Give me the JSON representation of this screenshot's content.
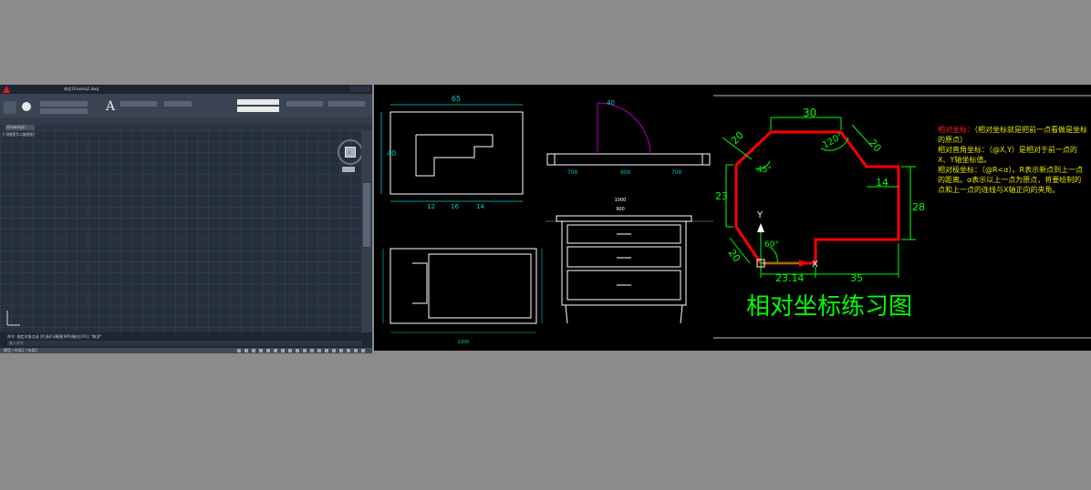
{
  "autocad": {
    "window_title": "欢迎 Drawing1.dwg",
    "file_tab": "Drawing1",
    "viewport_label": "[-][俯视][二维线框]",
    "viewcube_label": "上",
    "command_line": "命令: 指定对角点或 [栏选(F)/圈围(WP)/圈交(CP)]: *取消*",
    "command_prompt": "键入命令",
    "layout_tabs": "模型 / 布局1 / 布局2"
  },
  "furniture_drawings": {
    "top_left": {
      "width": "65",
      "height": "40",
      "dims": [
        "12",
        "16",
        "14"
      ]
    },
    "door": {
      "radius": "40",
      "dims": [
        "700",
        "900",
        "700"
      ]
    },
    "dresser": {
      "overall": "1000",
      "inner": "900"
    },
    "side_view": {
      "total": "2200"
    }
  },
  "coordinate_exercise": {
    "title": "相对坐标练习图",
    "colors": {
      "outline": "#ff0000",
      "dimension": "#00ff00",
      "text_yellow": "#e6e600",
      "text_red": "#ff2020"
    },
    "dims": {
      "top": "30",
      "upper_left_diag": "20",
      "upper_right_diag": "20",
      "left": "23",
      "right": "28",
      "step": "14",
      "lower_left_diag": "20",
      "bottom_left": "23.14",
      "bottom_right": "35",
      "angle_120": "120°",
      "angle_45": "45°",
      "angle_60": "60°",
      "axis_y": "Y",
      "axis_x": "X"
    },
    "notes": [
      {
        "label": "相对坐标：",
        "text": "（相对坐标就是把前一点看做是坐标的原点）"
      },
      {
        "label": "相对直角坐标：",
        "text": "（@X,Y）是相对于前一点的X、Y轴坐标值。"
      },
      {
        "label": "相对极坐标：",
        "text": "（@R<α）。R表示新点到上一点的距离。α表示以上一点为原点，将要绘制的点和上一点的连线与X轴正向的夹角。"
      }
    ]
  }
}
